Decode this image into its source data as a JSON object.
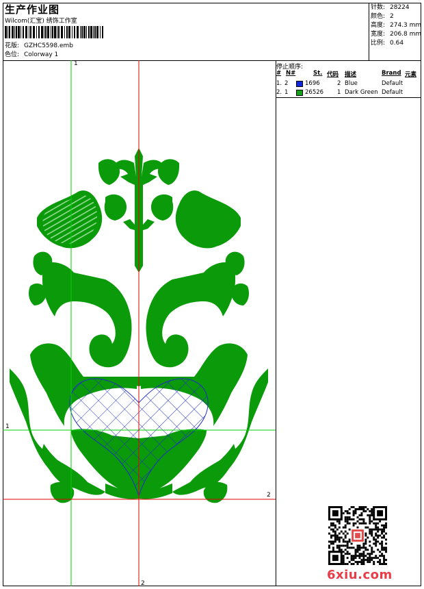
{
  "header": {
    "title": "生产作业图",
    "subtitle": "Wilcom(汇宝) 绣饰工作室",
    "design_label": "花版:",
    "design_value": "GZHC5598.emb",
    "colorway_label": "色位:",
    "colorway_value": "Colorway 1"
  },
  "stats": [
    {
      "label": "针数:",
      "value": "28224"
    },
    {
      "label": "颜色:",
      "value": "2"
    },
    {
      "label": "高度:",
      "value": "274.3 mm"
    },
    {
      "label": "宽度:",
      "value": "206.8 mm"
    },
    {
      "label": "比例:",
      "value": "0.64"
    }
  ],
  "stop_sequence": {
    "title": "停止顺序:",
    "columns": [
      "#",
      "N#",
      "St.",
      "代码",
      "描述",
      "Brand",
      "元素"
    ],
    "rows": [
      {
        "index": "1.",
        "n": "2",
        "color": "#1028d8",
        "stitches": "1696",
        "code": "2",
        "description": "Blue",
        "brand": "Default"
      },
      {
        "index": "2.",
        "n": "1",
        "color": "#17a01b",
        "stitches": "26526",
        "code": "1",
        "description": "Dark Green",
        "brand": "Default"
      }
    ]
  },
  "axis_labels": {
    "v_green": "1",
    "h_green": "1",
    "h_red": "2",
    "v_red": "2"
  },
  "watermark": {
    "site": "6xiu.com"
  },
  "colors": {
    "green_line": "#00d000",
    "red_line": "#e00000",
    "embroidery": "#0a9a0a",
    "mesh": "#2030c0"
  }
}
